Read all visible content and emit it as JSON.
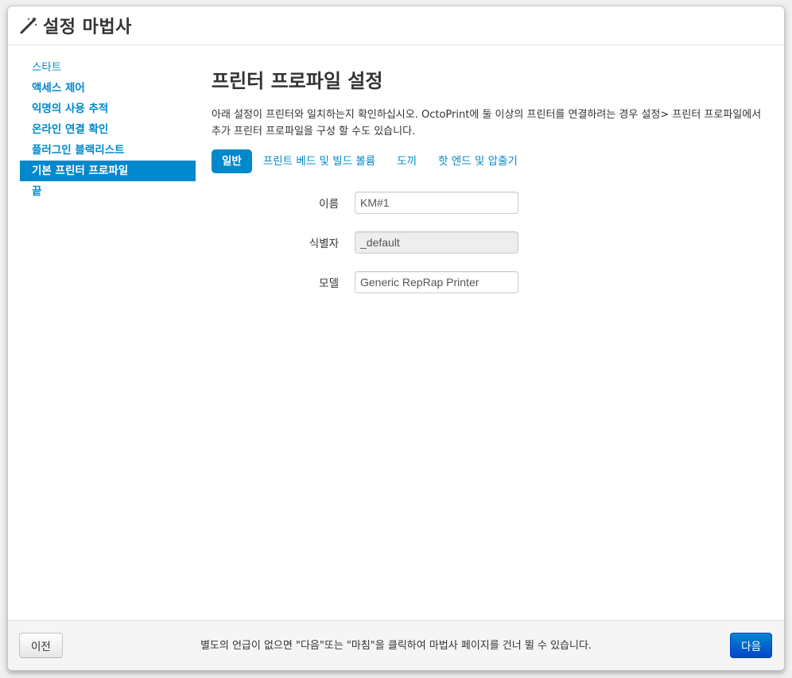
{
  "dialog": {
    "title": "설정 마법사",
    "icon": "magic-wand-icon"
  },
  "sidebar": {
    "items": [
      {
        "label": "스타트"
      },
      {
        "label": "액세스 제어"
      },
      {
        "label": "익명의 사용 추적"
      },
      {
        "label": "온라인 연결 확인"
      },
      {
        "label": "플러그인 블랙리스트"
      },
      {
        "label": "기본 프린터 프로파일"
      },
      {
        "label": "끝"
      }
    ],
    "active_index": 5
  },
  "main": {
    "heading": "프린터 프로파일 설정",
    "description": "아래 설정이 프린터와 일치하는지 확인하십시오. OctoPrint에 둘 이상의 프린터를 연결하려는 경우 설정> 프린터 프로파일에서 추가 프린터 프로파일을 구성 할 수도 있습니다.",
    "tabs": [
      {
        "label": "일반"
      },
      {
        "label": "프린트 베드 및 빌드 볼륨"
      },
      {
        "label": "도끼"
      },
      {
        "label": "핫 엔드 및 압출기"
      }
    ],
    "active_tab": 0,
    "form": {
      "name_label": "이름",
      "name_value": "KM#1",
      "identifier_label": "식별자",
      "identifier_value": "_default",
      "model_label": "모델",
      "model_value": "Generic RepRap Printer"
    }
  },
  "footer": {
    "prev_label": "이전",
    "note": "별도의 언급이 없으면 \"다음\"또는 \"마침\"을 클릭하여 마법사 페이지를 건너 뛸 수 있습니다.",
    "next_label": "다음"
  },
  "colors": {
    "accent": "#0088cc",
    "primary_button": "#0055cc"
  }
}
